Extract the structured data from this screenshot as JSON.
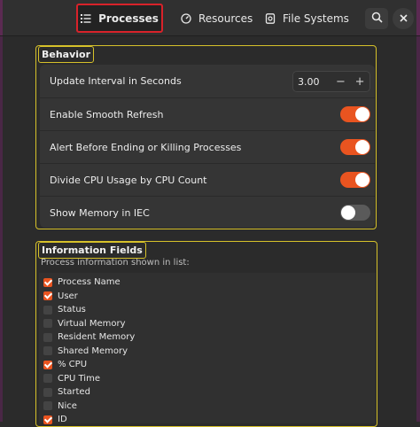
{
  "tabs": [
    {
      "label": "Processes",
      "icon": "list-icon",
      "active": true
    },
    {
      "label": "Resources",
      "icon": "gauge-icon",
      "active": false
    },
    {
      "label": "File Systems",
      "icon": "disk-icon",
      "active": false
    }
  ],
  "header_buttons": {
    "search_icon": "search-icon",
    "close_icon": "close-icon"
  },
  "behavior": {
    "title": "Behavior",
    "update_interval": {
      "label": "Update Interval in Seconds",
      "value": "3.00",
      "minus": "−",
      "plus": "+"
    },
    "smooth_refresh": {
      "label": "Enable Smooth Refresh",
      "on": true
    },
    "alert_kill": {
      "label": "Alert Before Ending or Killing Processes",
      "on": true
    },
    "divide_cpu": {
      "label": "Divide CPU Usage by CPU Count",
      "on": true
    },
    "memory_iec": {
      "label": "Show Memory in IEC",
      "on": false
    }
  },
  "info_fields": {
    "title": "Information Fields",
    "subtitle": "Process information shown in list:",
    "items": [
      {
        "label": "Process Name",
        "checked": true
      },
      {
        "label": "User",
        "checked": true
      },
      {
        "label": "Status",
        "checked": false
      },
      {
        "label": "Virtual Memory",
        "checked": false
      },
      {
        "label": "Resident Memory",
        "checked": false
      },
      {
        "label": "Shared Memory",
        "checked": false
      },
      {
        "label": "% CPU",
        "checked": true
      },
      {
        "label": "CPU Time",
        "checked": false
      },
      {
        "label": "Started",
        "checked": false
      },
      {
        "label": "Nice",
        "checked": false
      },
      {
        "label": "ID",
        "checked": true
      }
    ]
  },
  "colors": {
    "accent": "#e95420",
    "highlight": "#d6c12a",
    "active_tab_border": "#d8222a"
  }
}
